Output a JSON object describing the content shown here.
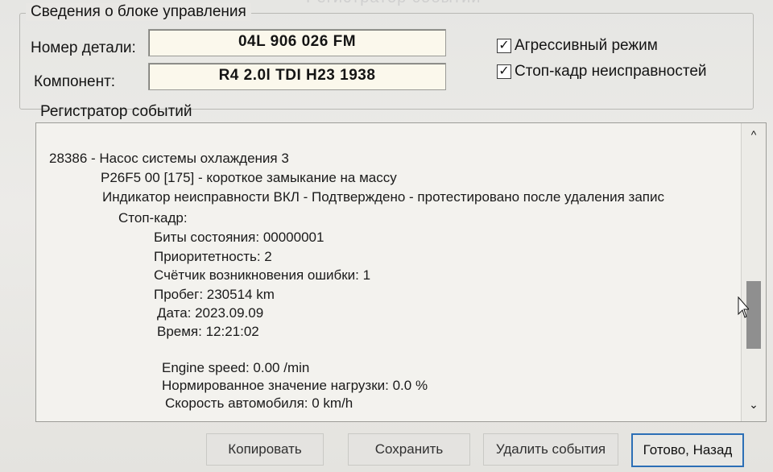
{
  "window": {
    "title": "Регистратор событий"
  },
  "control_unit": {
    "legend": "Сведения о блоке управления",
    "part_label": "Номер детали:",
    "part_value": "04L 906 026 FM",
    "component_label": "Компонент:",
    "component_value": "R4 2.0l TDI   H23 1938",
    "aggressive_mode": {
      "label": "Агрессивный режим",
      "checked": true
    },
    "freeze_frame": {
      "label": "Стоп-кадр неисправностей",
      "checked": true
    }
  },
  "event_log": {
    "title": "Регистратор событий",
    "lines": [
      "28386 - Насос системы охлаждения 3",
      "P26F5 00 [175] - короткое замыкание на массу",
      "Индикатор неисправности ВКЛ - Подтверждено - протестировано после удаления запис",
      "Стоп-кадр:",
      "Биты состояния: 00000001",
      "Приоритетность: 2",
      "Счётчик возникновения ошибки: 1",
      "Пробег: 230514 km",
      "Дата: 2023.09.09",
      "Время: 12:21:02",
      "Engine speed: 0.00 /min",
      "Нормированное значение нагрузки: 0.0 %",
      "Скорость автомобиля: 0 km/h"
    ]
  },
  "buttons": {
    "copy": "Копировать",
    "save": "Сохранить",
    "delete": "Удалить события",
    "done": "Готово, Назад"
  },
  "icons": {
    "checkbox": "checkmark-icon",
    "scroll_up": "chevron-up-icon",
    "scroll_down": "chevron-down-icon",
    "cursor": "mouse-pointer-icon"
  },
  "colors": {
    "accent_border": "#2c6fb6",
    "field_bg": "#fbf8ec"
  }
}
